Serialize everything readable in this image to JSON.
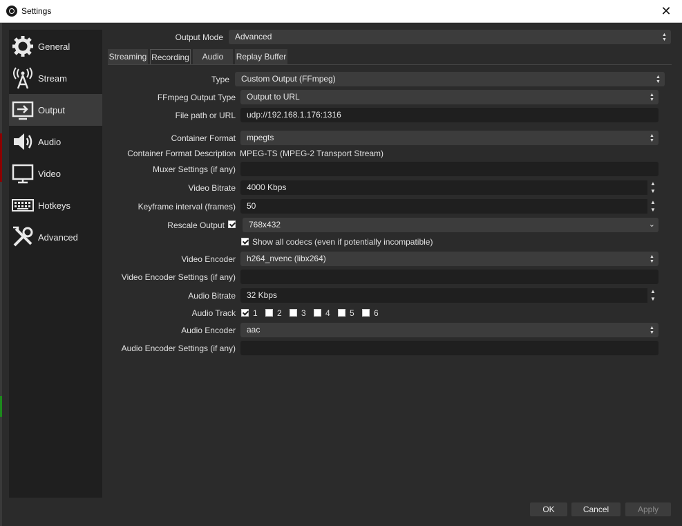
{
  "window": {
    "title": "Settings",
    "close_glyph": "✕"
  },
  "sidebar": {
    "items": [
      {
        "label": "General",
        "icon": "gear-icon"
      },
      {
        "label": "Stream",
        "icon": "antenna-icon"
      },
      {
        "label": "Output",
        "icon": "output-icon"
      },
      {
        "label": "Audio",
        "icon": "speaker-icon"
      },
      {
        "label": "Video",
        "icon": "monitor-icon"
      },
      {
        "label": "Hotkeys",
        "icon": "keyboard-icon"
      },
      {
        "label": "Advanced",
        "icon": "tools-icon"
      }
    ],
    "active": "Output"
  },
  "output_mode": {
    "label": "Output Mode",
    "value": "Advanced"
  },
  "tabs": [
    {
      "label": "Streaming"
    },
    {
      "label": "Recording"
    },
    {
      "label": "Audio"
    },
    {
      "label": "Replay Buffer"
    }
  ],
  "active_tab": "Recording",
  "form": {
    "type": {
      "label": "Type",
      "value": "Custom Output (FFmpeg)"
    },
    "ffmpeg_output_type": {
      "label": "FFmpeg Output Type",
      "value": "Output to URL"
    },
    "file_path": {
      "label": "File path or URL",
      "value": "udp://192.168.1.176:1316"
    },
    "container_format": {
      "label": "Container Format",
      "value": "mpegts"
    },
    "container_format_desc": {
      "label": "Container Format Description",
      "value": "MPEG-TS (MPEG-2 Transport Stream)"
    },
    "muxer_settings": {
      "label": "Muxer Settings (if any)",
      "value": ""
    },
    "video_bitrate": {
      "label": "Video Bitrate",
      "value": "4000 Kbps"
    },
    "keyframe_interval": {
      "label": "Keyframe interval (frames)",
      "value": "50"
    },
    "rescale_output": {
      "label": "Rescale Output",
      "checked": true,
      "value": "768x432"
    },
    "show_all_codecs": {
      "label": "Show all codecs (even if potentially incompatible)",
      "checked": true
    },
    "video_encoder": {
      "label": "Video Encoder",
      "value": "h264_nvenc (libx264)"
    },
    "video_encoder_settings": {
      "label": "Video Encoder Settings (if any)",
      "value": ""
    },
    "audio_bitrate": {
      "label": "Audio Bitrate",
      "value": "32 Kbps"
    },
    "audio_track": {
      "label": "Audio Track",
      "tracks": [
        {
          "label": "1",
          "checked": true
        },
        {
          "label": "2",
          "checked": false
        },
        {
          "label": "3",
          "checked": false
        },
        {
          "label": "4",
          "checked": false
        },
        {
          "label": "5",
          "checked": false
        },
        {
          "label": "6",
          "checked": false
        }
      ]
    },
    "audio_encoder": {
      "label": "Audio Encoder",
      "value": "aac"
    },
    "audio_encoder_settings": {
      "label": "Audio Encoder Settings (if any)",
      "value": ""
    }
  },
  "buttons": {
    "ok": "OK",
    "cancel": "Cancel",
    "apply": "Apply"
  }
}
